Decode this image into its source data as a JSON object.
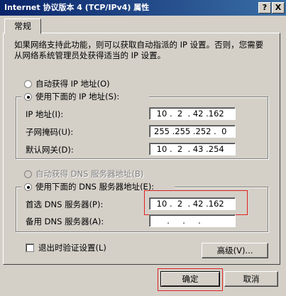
{
  "window": {
    "title": "Internet 协议版本 4 (TCP/IPv4) 属性",
    "help_label": "?",
    "close_label": "X"
  },
  "tabs": [
    {
      "label": "常规"
    }
  ],
  "description": "如果网络支持此功能，则可以获取自动指派的 IP 设置。否则，您需要从网络系统管理员处获得适当的 IP 设置。",
  "ip_section": {
    "auto_label": "自动获得 IP 地址(O)",
    "manual_label": "使用下面的 IP 地址(S):",
    "selected": "manual",
    "fields": [
      {
        "label": "IP 地址(I):",
        "value": " 10 .  2  . 42 .162"
      },
      {
        "label": "子网掩码(U):",
        "value": "255 .255 .252 .  0"
      },
      {
        "label": "默认网关(D):",
        "value": " 10 .  2  . 43 .254"
      }
    ]
  },
  "dns_section": {
    "auto_label": "自动获得 DNS 服务器地址(B)",
    "manual_label": "使用下面的 DNS 服务器地址(E):",
    "selected": "manual",
    "fields": [
      {
        "label": "首选 DNS 服务器(P):",
        "value": " 10 .  2  . 42 .162"
      },
      {
        "label": "备用 DNS 服务器(A):",
        "value": "     .     .     ."
      }
    ]
  },
  "validate_label": "退出时验证设置(L)",
  "validate_checked": false,
  "advanced_label": "高级(V)...",
  "ok_label": "确定",
  "cancel_label": "取消",
  "colors": {
    "titlebar": "#0a246a",
    "face": "#d4d0c8",
    "highlight_box": "#e02020"
  }
}
